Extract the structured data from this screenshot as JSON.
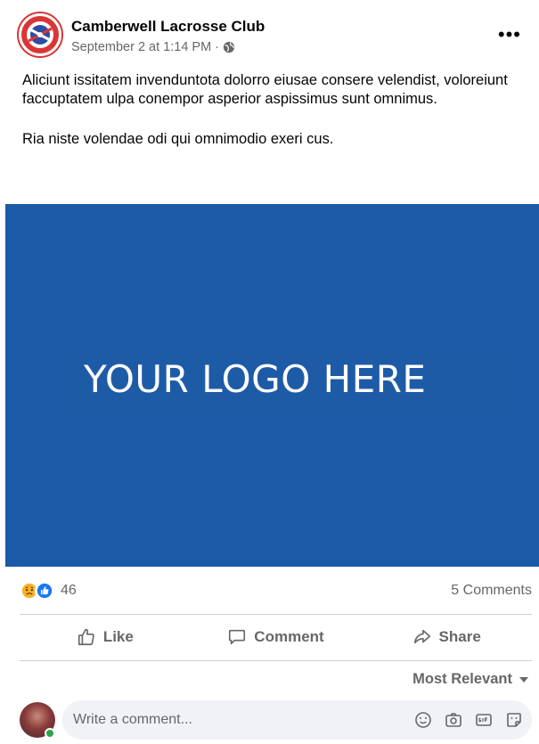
{
  "post": {
    "author": "Camberwell Lacrosse Club",
    "timestamp": "September 2 at 1:14 PM",
    "separator": "·",
    "more_label": "•••",
    "text_paragraphs": [
      "Aliciunt issitatem invenduntota dolorro eiusae consere velendist, voloreiunt faccuptatem ulpa conempor asperior aspissimus sunt omnimus.",
      "Ria niste volendae odi qui omnimodio exeri cus."
    ],
    "logo_text": "YOUR LOGO HERE",
    "media_color": "#1a5aa6"
  },
  "stats": {
    "reactions": [
      "sad-reaction-icon",
      "like-reaction-icon"
    ],
    "reaction_count": "46",
    "comments": "5 Comments"
  },
  "actions": {
    "like": "Like",
    "comment": "Comment",
    "share": "Share"
  },
  "comments": {
    "sort_label": "Most Relevant",
    "input_placeholder": "Write a comment..."
  },
  "colors": {
    "secondary_text": "#65676b",
    "online": "#31a24c",
    "like_blue": "#1877f2"
  }
}
